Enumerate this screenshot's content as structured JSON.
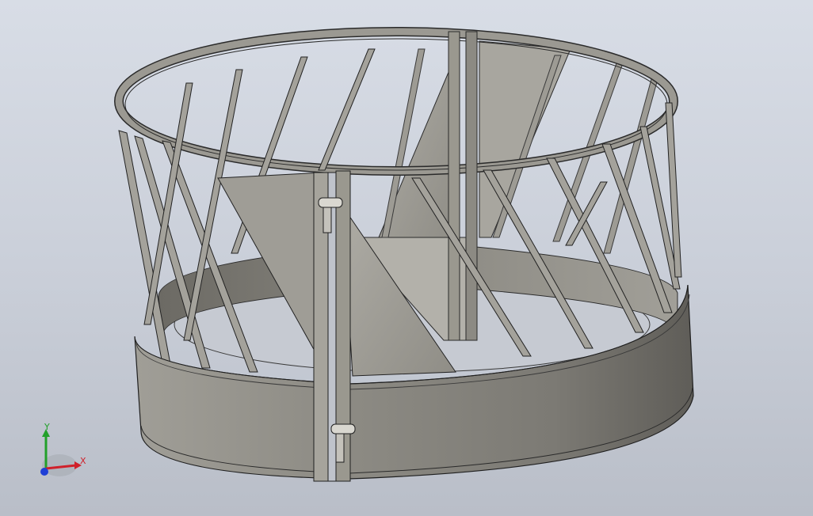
{
  "viewport": {
    "background_top": "#d8dde6",
    "background_bottom": "#b9bec8",
    "model_color": "#8f8d86",
    "edge_color": "#2a2a2a"
  },
  "triad": {
    "x_label": "X",
    "y_label": "Y",
    "x_color": "#d0202a",
    "y_color": "#22a02a",
    "z_color": "#1f3fd6"
  },
  "model": {
    "hinge_icon": "hinge-icon"
  }
}
